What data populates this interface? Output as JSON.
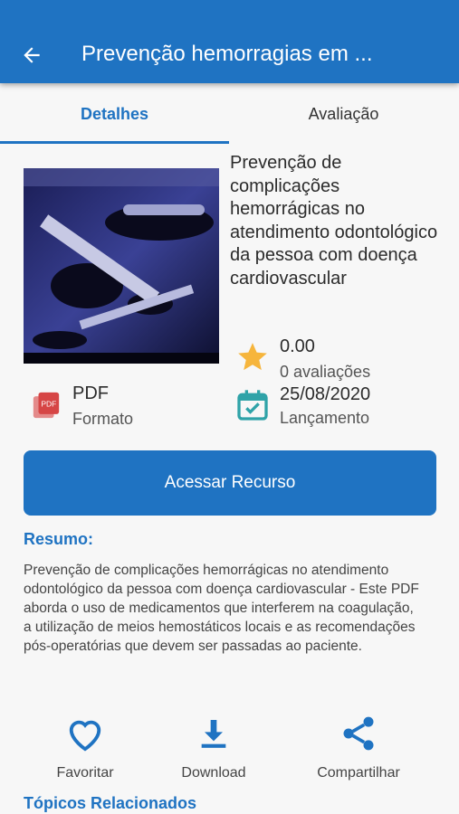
{
  "appbar": {
    "title": "Prevenção hemorragias em ...",
    "back_icon": "arrow-left-icon"
  },
  "tabs": [
    {
      "label": "Detalhes",
      "active": true
    },
    {
      "label": "Avaliação",
      "active": false
    }
  ],
  "resource": {
    "title": "Prevenção de complicações hemorrágicas no atendimento odontológico da pessoa com doença cardiovascular",
    "rating": "0.00",
    "rating_count": "0 avaliações",
    "format_value": "PDF",
    "format_label": "Formato",
    "release_value": "25/08/2020",
    "release_label": "Lançamento"
  },
  "access_button": "Acessar Recurso",
  "summary": {
    "heading": "Resumo:",
    "text": "Prevenção de complicações hemorrágicas no atendimento odontológico da pessoa com doença cardiovascular - Este PDF aborda o uso de medicamentos que interferem na coagulação,  a utilização de meios hemostáticos locais e as recomendações pós-operatórias que devem ser passadas ao paciente."
  },
  "actions": {
    "favorite": "Favoritar",
    "download": "Download",
    "share": "Compartilhar"
  },
  "related_heading": "Tópicos Relacionados",
  "colors": {
    "primary": "#1f73c2",
    "star": "#f6b53c",
    "pdf": "#d64545",
    "calendar": "#2fa3a8"
  }
}
